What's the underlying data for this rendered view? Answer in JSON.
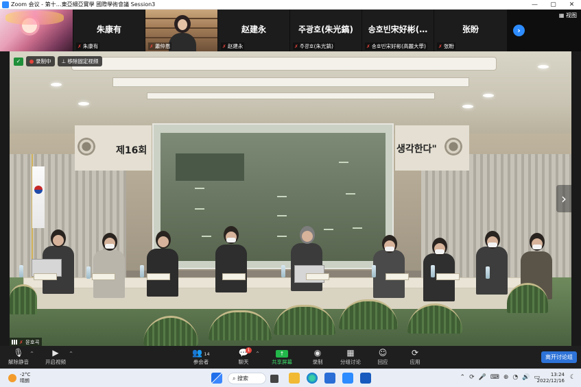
{
  "window": {
    "title": "Zoom 会议 - 第十…東亞細亞實學 國際學術會議 Session3",
    "controls": [
      "—",
      "▢",
      "✕"
    ]
  },
  "gallery": {
    "view_label": "视图",
    "tiles": [
      {
        "big_name": "",
        "small_name": ""
      },
      {
        "big_name": "朱康有",
        "small_name": "朱康有"
      },
      {
        "big_name": "",
        "small_name": "蕭仲恩"
      },
      {
        "big_name": "赵建永",
        "small_name": "赵建永"
      },
      {
        "big_name": "주광호(朱光鎬)",
        "small_name": "주광호(朱光鎬)"
      },
      {
        "big_name": "송호빈宋好彬(…",
        "small_name": "송호빈宋好彬(高麗大學)"
      },
      {
        "big_name": "张盼",
        "small_name": "张盼"
      }
    ]
  },
  "video": {
    "recording_label": "录制中",
    "unpin_label": "移除固定视频",
    "speaker_name": "윤호곡",
    "banner_left": "제16회",
    "banner_right": "생각한다\""
  },
  "toolbar": {
    "unmute": "解除静音",
    "start_video": "开启视频",
    "participants": "参会者",
    "participants_count": "14",
    "chat": "聊天",
    "chat_badge": "1",
    "share": "共享屏幕",
    "record": "录制",
    "breakout": "分组讨论",
    "reactions": "回应",
    "apps": "应用",
    "leave_breakout": "离开讨论组"
  },
  "taskbar": {
    "temperature": "-2°C",
    "weather": "晴朗",
    "search": "搜索",
    "time": "13:24",
    "date": "2022/12/16"
  },
  "colors": {
    "zoom_blue": "#2d8cff",
    "share_green": "#22b84a",
    "alert_red": "#e3443c",
    "toolbar_bg": "#1f1f1f"
  }
}
